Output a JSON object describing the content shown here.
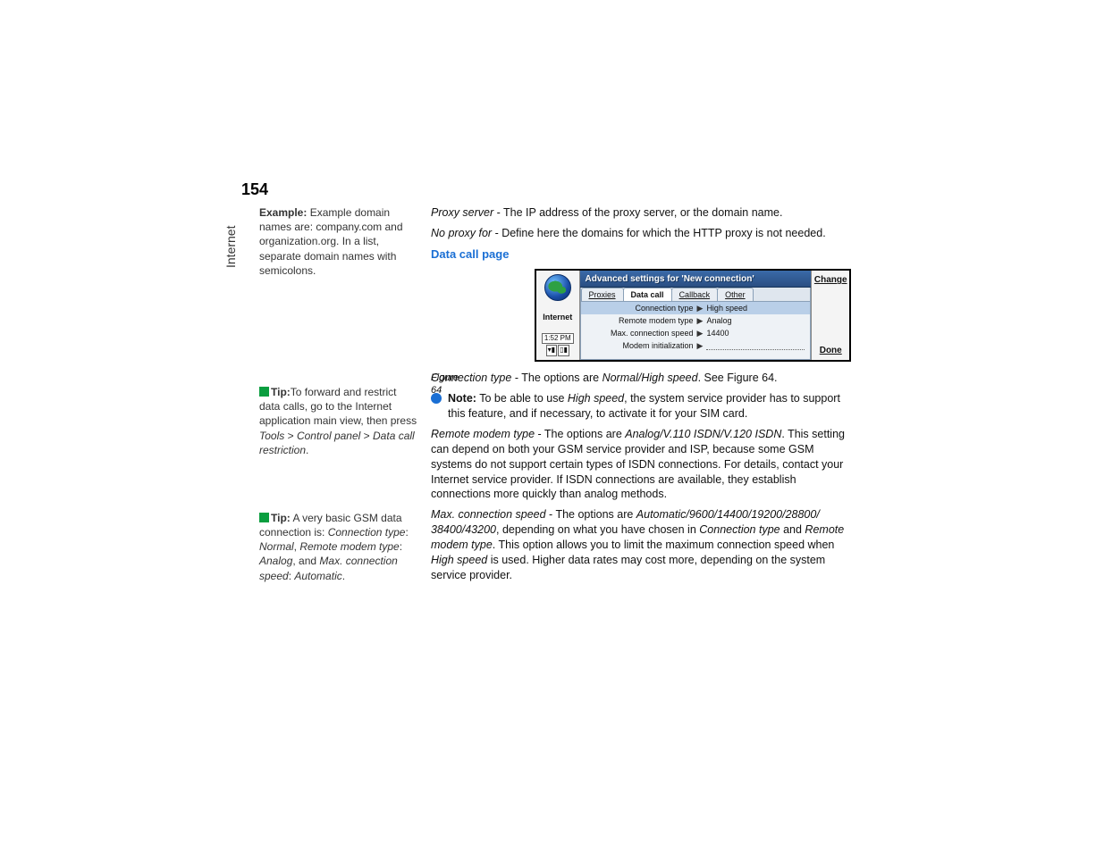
{
  "page_number": "154",
  "side_label": "Internet",
  "sidebar": {
    "example": {
      "lead": "Example:",
      "text": " Example domain names are: company.com and organization.org. In a list, separate domain names with semicolons."
    },
    "tip1": {
      "lead": "Tip:",
      "text_a": "To forward and restrict data calls, go to the Internet application main view, then press ",
      "path_a": "Tools",
      "sep1": " > ",
      "path_b": "Control panel",
      "sep2": " > ",
      "path_c": "Data call restriction",
      "period": "."
    },
    "tip2": {
      "lead": "Tip:",
      "text_a": " A very basic GSM data connection is: ",
      "ct": "Connection type",
      "ct_sep": ": ",
      "ct_v": "Normal",
      "rmt": "Remote modem type",
      "rmt_sep": ": ",
      "rmt_v": "Analog",
      "and": ", and ",
      "mcs": "Max. connection speed",
      "mcs_sep": ": ",
      "mcs_v": "Automatic",
      "period": "."
    }
  },
  "main": {
    "proxy_server": {
      "term": "Proxy server",
      "text": " - The IP address of the proxy server, or the domain name."
    },
    "no_proxy": {
      "term": "No proxy for",
      "text": " - Define here the domains for which the HTTP proxy is not needed."
    },
    "h_data_call": "Data call page",
    "figcaption": "Figure 64",
    "conn_type": {
      "term": "Connection type",
      "text_a": " - The options are ",
      "opts": "Normal/High speed",
      "text_b": ". See Figure 64."
    },
    "note": {
      "lead": "Note:",
      "text_a": " To be able to use ",
      "hs": "High speed",
      "text_b": ", the system service provider has to support this feature, and if necessary, to activate it for your SIM card."
    },
    "remote_modem": {
      "term": "Remote modem type",
      "text_a": " - The options are ",
      "opts": "Analog/V.110 ISDN/V.120 ISDN",
      "text_b": ". This setting can depend on both your GSM service provider and ISP, because some GSM systems do not support certain types of ISDN connections. For details, contact your Internet service provider. If ISDN connections are available, they establish connections more quickly than analog methods."
    },
    "max_speed": {
      "term": "Max. connection speed",
      "text_a": " - The options are ",
      "opts": "Automatic/9600/14400/19200/28800/ 38400/43200",
      "text_b": ", depending on what you have chosen in ",
      "ct": "Connection type",
      "text_c": " and ",
      "rmt": "Remote modem type",
      "text_d": ". This option allows you to limit the maximum connection speed when ",
      "hs": "High speed",
      "text_e": " is used. Higher data rates may cost more, depending on the system service provider."
    }
  },
  "device": {
    "side_label": "Internet",
    "time": "1:52 PM",
    "title": "Advanced settings for 'New connection'",
    "tabs": [
      "Proxies",
      "Data call",
      "Callback",
      "Other"
    ],
    "active_tab_index": 1,
    "rows": [
      {
        "label": "Connection type",
        "value": "High speed",
        "selected": true
      },
      {
        "label": "Remote modem type",
        "value": "Analog",
        "selected": false
      },
      {
        "label": "Max. connection speed",
        "value": "14400",
        "selected": false
      },
      {
        "label": "Modem initialization",
        "value": "",
        "selected": false
      }
    ],
    "softkeys": {
      "top": "Change",
      "bottom": "Done"
    }
  }
}
